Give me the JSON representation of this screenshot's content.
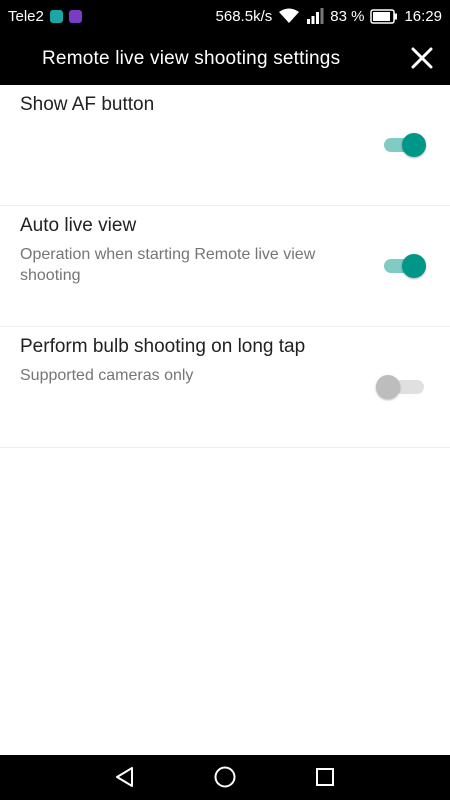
{
  "status_bar": {
    "carrier": "Tele2",
    "net_speed": "568.5k/s",
    "battery_pct": "83 %",
    "time": "16:29",
    "icons": [
      "app-badge-teal",
      "app-badge-purple",
      "wifi-icon",
      "signal-icon",
      "battery-icon"
    ]
  },
  "header": {
    "title": "Remote live view shooting settings",
    "close_icon": "close-icon"
  },
  "settings": [
    {
      "title": "Show AF button",
      "description": "",
      "enabled": true
    },
    {
      "title": "Auto live view",
      "description": "Operation when starting Remote live view shooting",
      "enabled": true
    },
    {
      "title": "Perform bulb shooting on long tap",
      "description": "Supported cameras only",
      "enabled": false
    }
  ],
  "colors": {
    "accent": "#009688",
    "accent_track": "#80cbc4",
    "off_thumb": "#bdbdbd",
    "off_track": "#e0e0e0"
  },
  "nav_bar": {
    "icons": [
      "back-icon",
      "home-icon",
      "recents-icon"
    ]
  }
}
